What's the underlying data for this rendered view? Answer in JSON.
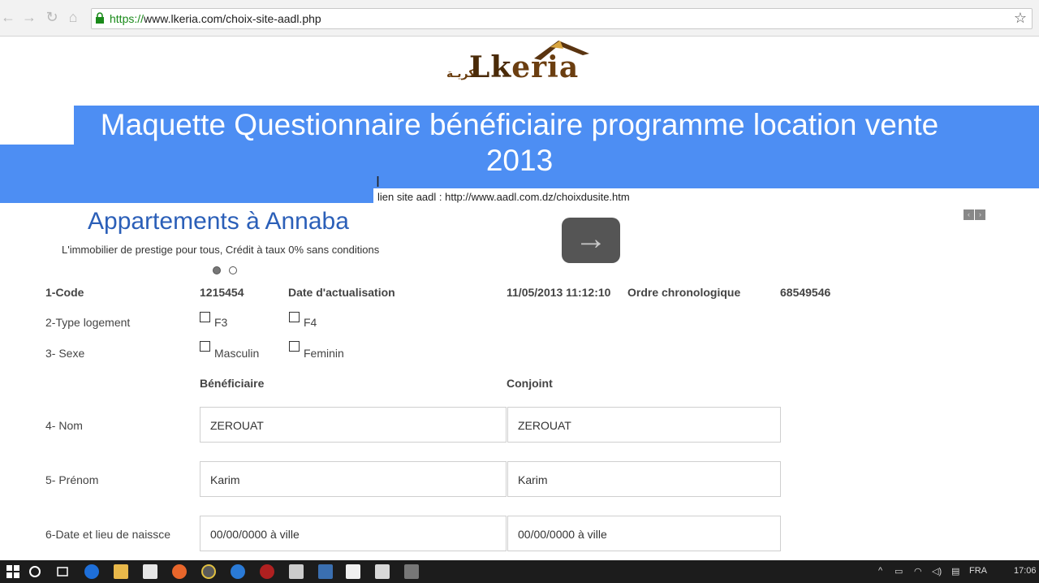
{
  "browser": {
    "url_protocol": "https://",
    "url_rest": "www.lkeria.com/choix-site-aadl.php",
    "back_icon": "back-arrow-icon",
    "forward_icon": "forward-arrow-icon",
    "reload_icon": "reload-icon",
    "home_icon": "home-icon",
    "star_icon": "star-icon"
  },
  "logo": {
    "brand_big": "Lk",
    "brand_rest": "eria",
    "arabic": "لكريـة"
  },
  "banner": {
    "title_line1": "Maquette Questionnaire bénéficiaire programme location vente",
    "title_line2": "2013",
    "old_link": "lien site aadl : http://www.aadl.com.dz/choixdusite.htm",
    "color": "#4d8ef3"
  },
  "slider": {
    "title": "Appartements à Annaba",
    "subtitle": "L'immobilier de prestige pour tous, Crédit à taux 0% sans conditions",
    "next_glyph": "→"
  },
  "form": {
    "code_label": "1-Code",
    "code_value": "1215454",
    "date_label": "Date d'actualisation",
    "date_value": "11/05/2013 11:12:10",
    "ordre_label": "Ordre chronologique",
    "ordre_value": "68549546",
    "type_label": "2-Type logement",
    "type_opt1": "F3",
    "type_opt2": "F4",
    "sexe_label": "3- Sexe",
    "sexe_opt1": "Masculin",
    "sexe_opt2": "Feminin",
    "col_beneficiaire": "Bénéficiaire",
    "col_conjoint": "Conjoint",
    "nom_label": "4- Nom",
    "nom_benef": "ZEROUAT",
    "nom_conj": "ZEROUAT",
    "prenom_label": "5- Prénom",
    "prenom_benef": "Karim",
    "prenom_conj": "Karim",
    "naiss_label": "6-Date et lieu de naissce",
    "naiss_benef": "00/00/0000 à ville",
    "naiss_conj": "00/00/0000 à ville"
  },
  "taskbar": {
    "lang": "FRA",
    "time": "17:06"
  }
}
